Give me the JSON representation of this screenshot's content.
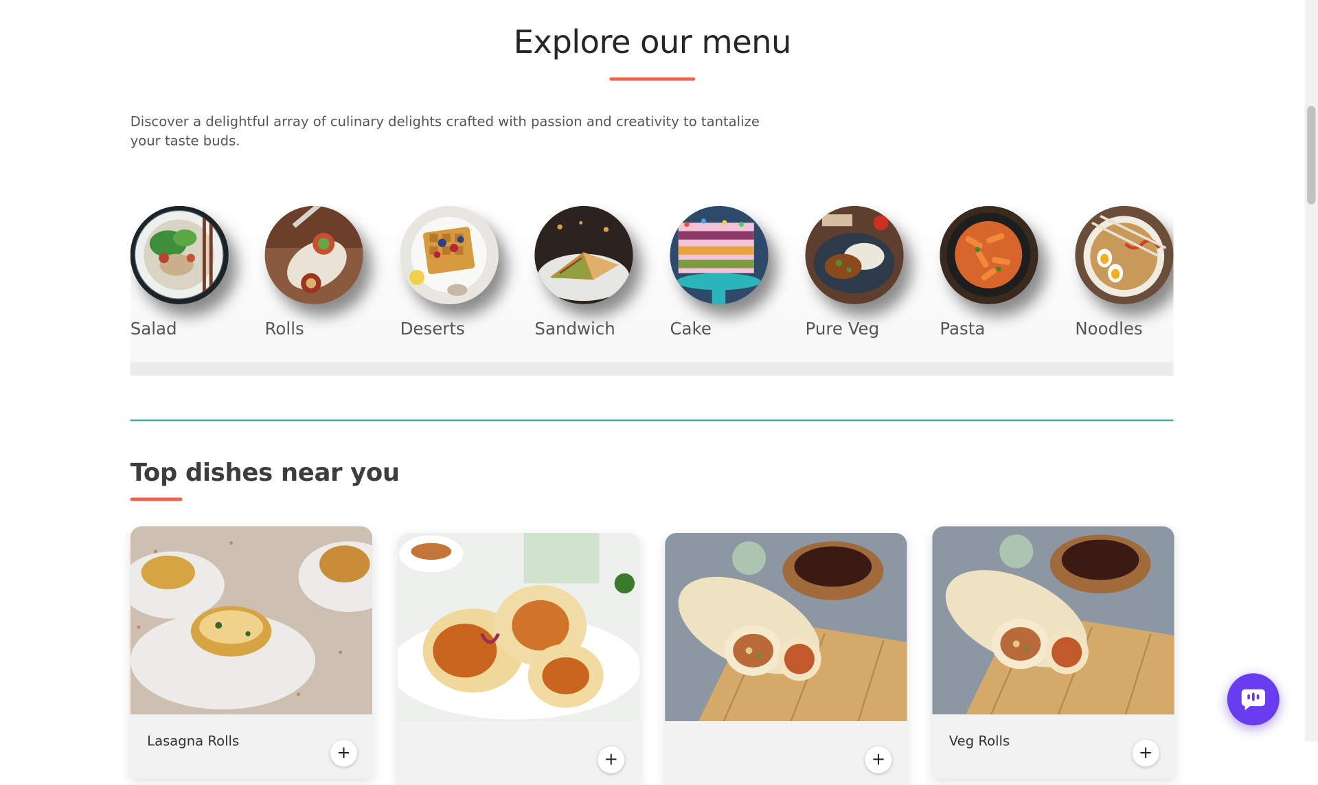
{
  "menu_section": {
    "title": "Explore our menu",
    "description": "Discover a delightful array of culinary delights crafted with passion and creativity to tantalize your taste buds.",
    "categories": [
      {
        "label": "Salad",
        "icon": "salad-bowl-image"
      },
      {
        "label": "Rolls",
        "icon": "rolls-wrap-image"
      },
      {
        "label": "Deserts",
        "icon": "waffle-dessert-image"
      },
      {
        "label": "Sandwich",
        "icon": "sandwich-image"
      },
      {
        "label": "Cake",
        "icon": "cake-image"
      },
      {
        "label": "Pure Veg",
        "icon": "veg-curry-image"
      },
      {
        "label": "Pasta",
        "icon": "pasta-image"
      },
      {
        "label": "Noodles",
        "icon": "noodle-bowl-image"
      }
    ]
  },
  "top_dishes": {
    "title": "Top dishes near you",
    "dishes": [
      {
        "name": "Lasagna Rolls",
        "add_label": "+",
        "image": "lasagna-rolls-image"
      },
      {
        "name": "",
        "add_label": "+",
        "image": "chicken-wraps-image"
      },
      {
        "name": "",
        "add_label": "+",
        "image": "burrito-roll-image"
      },
      {
        "name": "Veg Rolls",
        "add_label": "+",
        "image": "burrito-roll-image"
      }
    ]
  },
  "colors": {
    "accent": "#f0604a",
    "divider": "#3aad98",
    "chat_button": "#6a3cf0"
  },
  "chat_widget": {
    "icon": "chat-bubble-icon"
  }
}
